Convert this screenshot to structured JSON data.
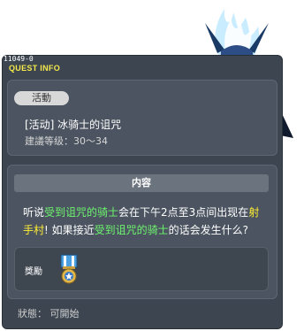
{
  "quest": {
    "id": "11049-0",
    "window_title": "QUEST INFO",
    "category_badge": "活動",
    "name": "[活动] 冰骑士的诅咒",
    "level_label": "建議等级：30～34",
    "content_header": "内容",
    "description": {
      "p1": "听说",
      "hl1": "受到诅咒的骑士",
      "p2": "会在下午2点至3点间出现在",
      "hl2": "射手村",
      "p3": "! 如果接近",
      "hl3": "受到诅咒的骑士",
      "p4": "的话会发生什么?"
    },
    "reward_label": "獎勵",
    "status_label": "狀態： 可開始"
  },
  "icons": {
    "reward_item": "medal-icon",
    "character": "ice-knight-character"
  },
  "colors": {
    "window_bg": "#3c4550",
    "title": "#f4e84a",
    "highlight_npc": "#6ef56e",
    "highlight_place": "#ffee33"
  }
}
